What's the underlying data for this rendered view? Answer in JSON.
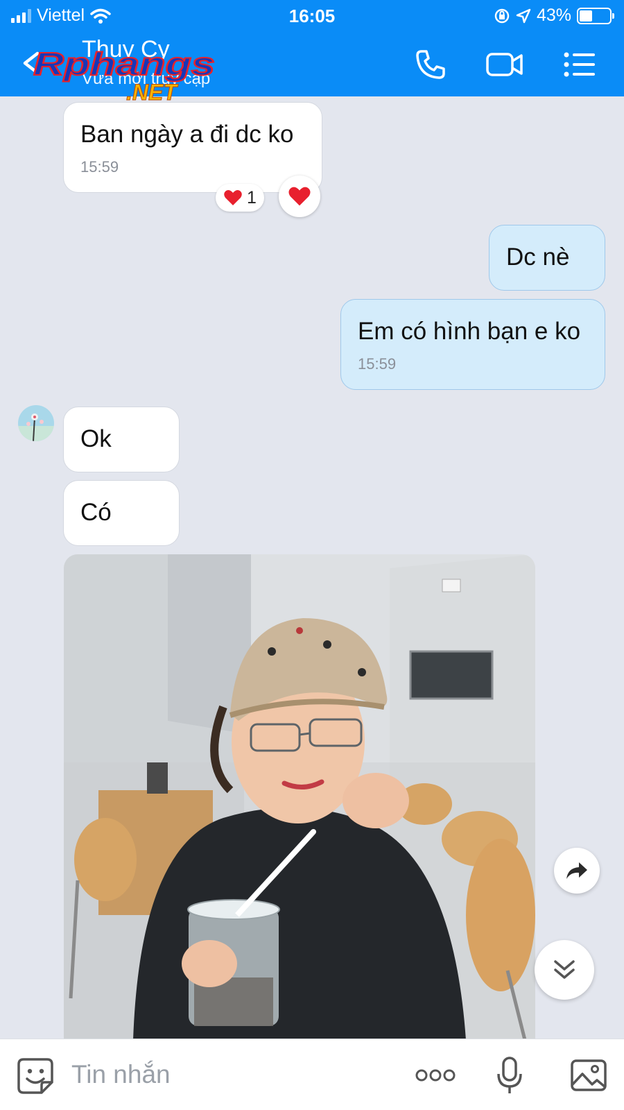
{
  "status_bar": {
    "carrier": "Viettel",
    "time": "16:05",
    "battery": "43%",
    "battery_level": 0.43
  },
  "header": {
    "contact_name": "Thuy Cy",
    "contact_status": "Vừa mới truy cập",
    "watermark_main": "Rphangs",
    "watermark_sub": ".NET"
  },
  "messages": [
    {
      "direction": "in",
      "text": "Ban ngày a đi dc ko",
      "time": "15:59"
    },
    {
      "direction": "out",
      "text": "Dc nè"
    },
    {
      "direction": "out",
      "text": "Em có hình bạn e ko",
      "time": "15:59"
    },
    {
      "direction": "in",
      "text": "Ok"
    },
    {
      "direction": "in",
      "text": "Có"
    }
  ],
  "reaction": {
    "emoji": "heart",
    "count": "1"
  },
  "input": {
    "placeholder": "Tin nhắn"
  },
  "icons": {
    "header": [
      "back-icon",
      "phone-icon",
      "video-call-icon",
      "menu-icon"
    ],
    "input_bar": [
      "sticker-icon",
      "more-icon",
      "microphone-icon",
      "image-icon"
    ],
    "floating": [
      "share-icon",
      "scroll-down-icon"
    ]
  },
  "colors": {
    "header": "#0a8cf7",
    "chat_background": "#e3e6ee",
    "outgoing_bubble": "#d4ecfb",
    "incoming_bubble": "#ffffff",
    "heart": "#e8202e"
  }
}
